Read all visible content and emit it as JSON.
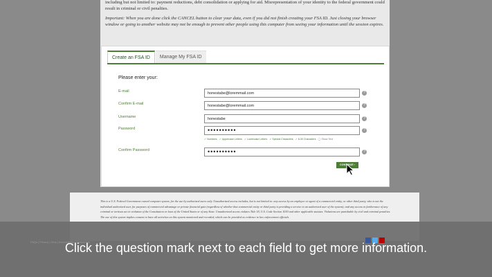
{
  "intro": {
    "line1": "including but not limited to: payment reductions, debt consolidation or applying for aid. Misrepresentation of your identity to the federal government could result in criminal or civil penalties.",
    "warning": "Important: When you are done click the CANCEL button to clear your data, even if you did not finish creating your FSA ID. Just closing your browser window or going to another website may not be enough to prevent other people using this computer from seeing your information until the session expires."
  },
  "tabs": [
    {
      "label": "Create an FSA ID"
    },
    {
      "label": "Manage My FSA ID"
    }
  ],
  "form": {
    "prompt": "Please enter your:",
    "fields": [
      {
        "label": "E-mail",
        "value": "honestabe@loremmail.com"
      },
      {
        "label": "Confirm E-mail",
        "value": "honestabe@loremmail.com"
      },
      {
        "label": "Username",
        "value": "honestabe"
      },
      {
        "label": "Password",
        "value": "••••••••••"
      },
      {
        "label": "Confirm Password",
        "value": "••••••••••"
      }
    ],
    "help": "?",
    "requirements": [
      "✓ Numbers",
      "✓ Uppercase Letters",
      "✓ Lowercase Letters",
      "✓ Special Characters",
      "✓ 8-30 Characters",
      "◯ Show Text"
    ],
    "continue_label": "CONTINUE ›"
  },
  "footer": {
    "text": "This is a U.S. Federal Government owned computer system, for the use by authorized users only. Unauthorized access includes, but is not limited to: any access by an employee or agent of a commercial entity, or other third party, who is not the individual authorized user, for purposes of commercial advantage or private financial gain (regardless of whether that commercial entity or third party is providing a service to an authorized user of the system); and any access in furtherance of any criminal or tortious act in violation of the Constitution or laws of the United States or of any State. Unauthorized access violates Title 18, U.S. Code Section 1030 and other applicable statutes. Violations are punishable by civil and criminal penalties. The use of this system implies consent to have all activities on this system monitored and recorded, which can be provided as evidence to law enforcement officials.",
    "links": "FAQs | Privacy | Help | Accessibility | Contact Us"
  },
  "caption": "Click the question mark next to each field to get more information."
}
